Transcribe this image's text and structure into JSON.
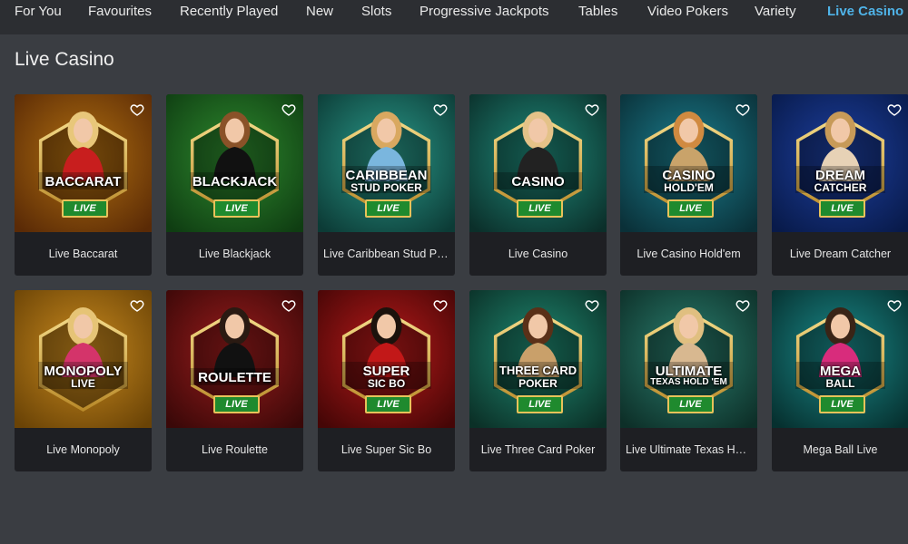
{
  "nav": {
    "items": [
      {
        "label": "For You",
        "active": false
      },
      {
        "label": "Favourites",
        "active": false
      },
      {
        "label": "Recently Played",
        "active": false
      },
      {
        "label": "New",
        "active": false
      },
      {
        "label": "Slots",
        "active": false
      },
      {
        "label": "Progressive Jackpots",
        "active": false
      },
      {
        "label": "Tables",
        "active": false
      },
      {
        "label": "Video Pokers",
        "active": false
      },
      {
        "label": "Variety",
        "active": false
      },
      {
        "label": "Live Casino",
        "active": true
      }
    ]
  },
  "section": {
    "title": "Live Casino"
  },
  "colors": {
    "accent": "#4fb3e8",
    "live_badge": "#1f8a2e",
    "badge_gold": "#e8c25a"
  },
  "games": [
    {
      "title": "Live Baccarat",
      "logo_line1": "BACCARAT",
      "logo_line2": "",
      "live": "LIVE",
      "bg": "#b06f10",
      "bg2": "#5a2a06",
      "hair": "#e8c77a",
      "outfit": "#c81e1e"
    },
    {
      "title": "Live Blackjack",
      "logo_line1": "BLACKJACK",
      "logo_line2": "",
      "live": "LIVE",
      "bg": "#2e8a2e",
      "bg2": "#0f3d12",
      "hair": "#8a5228",
      "outfit": "#111111"
    },
    {
      "title": "Live Caribbean Stud Poker",
      "logo_line1": "CARIBBEAN",
      "logo_line2": "STUD POKER",
      "live": "LIVE",
      "bg": "#2a9a8a",
      "bg2": "#0c3b36",
      "hair": "#d9a860",
      "outfit": "#7ab6de"
    },
    {
      "title": "Live Casino",
      "logo_line1": "CASINO",
      "logo_line2": "",
      "live": "LIVE",
      "bg": "#1f8a7a",
      "bg2": "#0b2f2a",
      "hair": "#e4c288",
      "outfit": "#222222"
    },
    {
      "title": "Live Casino Hold'em",
      "logo_line1": "CASINO",
      "logo_line2": "HOLD'EM",
      "live": "LIVE",
      "bg": "#1b7e8e",
      "bg2": "#0a3038",
      "hair": "#d08a40",
      "outfit": "#c9a36a"
    },
    {
      "title": "Live Dream Catcher",
      "logo_line1": "DREAM",
      "logo_line2": "CATCHER",
      "live": "LIVE",
      "bg": "#1d3f9e",
      "bg2": "#081a4a",
      "hair": "#c79a58",
      "outfit": "#e7d2b6"
    },
    {
      "title": "Live Monopoly",
      "logo_line1": "MONOPOLY",
      "logo_line2": "LIVE",
      "live": "",
      "bg": "#c98a1e",
      "bg2": "#6a4306",
      "hair": "#e6c476",
      "outfit": "#d4346a"
    },
    {
      "title": "Live Roulette",
      "logo_line1": "ROULETTE",
      "logo_line2": "",
      "live": "LIVE",
      "bg": "#9a1c1c",
      "bg2": "#3a0808",
      "hair": "#2a1a12",
      "outfit": "#111111"
    },
    {
      "title": "Live Super Sic Bo",
      "logo_line1": "SUPER",
      "logo_line2": "SIC BO",
      "live": "LIVE",
      "bg": "#b81a1a",
      "bg2": "#450606",
      "hair": "#1b120c",
      "outfit": "#c21818"
    },
    {
      "title": "Live Three Card Poker",
      "logo_line1": "THREE CARD",
      "logo_line2": "POKER",
      "live": "LIVE",
      "bg": "#1f8a72",
      "bg2": "#0b3027",
      "hair": "#5a3018",
      "outfit": "#c9a06a"
    },
    {
      "title": "Live Ultimate Texas Hold'em",
      "logo_line1": "ULTIMATE",
      "logo_line2": "TEXAS HOLD 'EM",
      "live": "LIVE",
      "bg": "#2a7e6e",
      "bg2": "#0d2f28",
      "hair": "#e0bf80",
      "outfit": "#d8b890"
    },
    {
      "title": "Mega Ball Live",
      "logo_line1": "MEGA",
      "logo_line2": "BALL",
      "live": "LIVE",
      "bg": "#1a8a8a",
      "bg2": "#06302f",
      "hair": "#3a2416",
      "outfit": "#d82c7c"
    }
  ]
}
